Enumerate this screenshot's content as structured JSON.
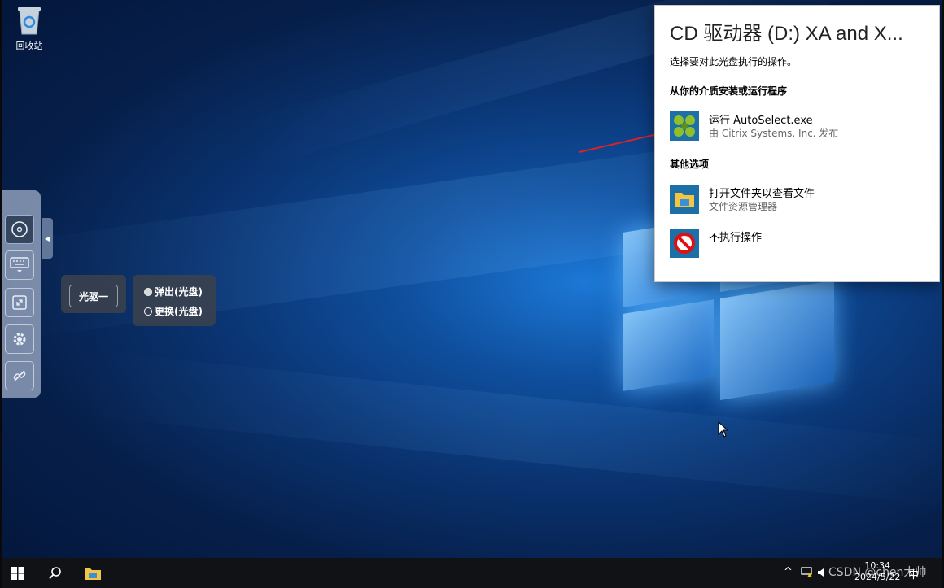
{
  "desktop": {
    "recycle_bin_label": "回收站"
  },
  "drive_popover": {
    "drive_label": "光驱一",
    "options": [
      "弹出(光盘)",
      "更换(光盘)"
    ]
  },
  "autoplay": {
    "title": "CD 驱动器 (D:) XA and X...",
    "subtitle": "选择要对此光盘执行的操作。",
    "section_install": "从你的介质安装或运行程序",
    "run_title": "运行 AutoSelect.exe",
    "run_publisher": "由 Citrix Systems, Inc. 发布",
    "section_other": "其他选项",
    "open_folder_title": "打开文件夹以查看文件",
    "open_folder_sub": "文件资源管理器",
    "no_action_title": "不执行操作"
  },
  "taskbar": {
    "time": "10:34",
    "date": "2024/5/22",
    "ime_label": "中"
  },
  "watermark": "CSDN @chen大帅",
  "colors": {
    "accent": "#1c78d6",
    "annotation_arrow": "#d9232b"
  }
}
